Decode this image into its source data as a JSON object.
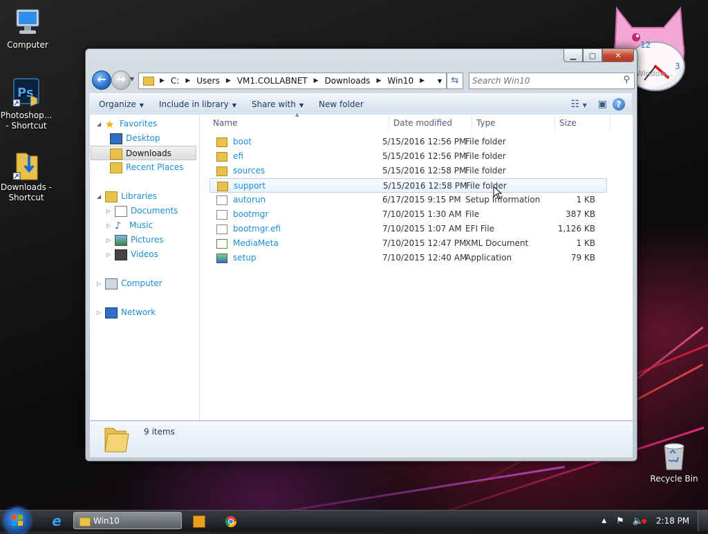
{
  "desktop": {
    "icons": [
      {
        "label": "Computer"
      },
      {
        "label": "Photoshop... - Shortcut"
      },
      {
        "label": "Downloads - Shortcut"
      },
      {
        "label": "Recycle Bin"
      }
    ],
    "gadget_text": "Window..."
  },
  "window": {
    "title": "Win10",
    "breadcrumb": [
      "C:",
      "Users",
      "VM1.COLLABNET",
      "Downloads",
      "Win10"
    ],
    "search_placeholder": "Search Win10",
    "toolbar": {
      "organize": "Organize",
      "include_in_library": "Include in library",
      "share_with": "Share with",
      "new_folder": "New folder"
    },
    "nav": {
      "favorites": "Favorites",
      "desktop": "Desktop",
      "downloads": "Downloads",
      "recent_places": "Recent Places",
      "libraries": "Libraries",
      "documents": "Documents",
      "music": "Music",
      "pictures": "Pictures",
      "videos": "Videos",
      "computer": "Computer",
      "network": "Network"
    },
    "columns": {
      "name": "Name",
      "date": "Date modified",
      "type": "Type",
      "size": "Size"
    },
    "files": [
      {
        "name": "boot",
        "date": "5/15/2016 12:56 PM",
        "type": "File folder",
        "size": "",
        "icon": "folder-icon"
      },
      {
        "name": "efi",
        "date": "5/15/2016 12:56 PM",
        "type": "File folder",
        "size": "",
        "icon": "folder-icon"
      },
      {
        "name": "sources",
        "date": "5/15/2016 12:58 PM",
        "type": "File folder",
        "size": "",
        "icon": "folder-icon"
      },
      {
        "name": "support",
        "date": "5/15/2016 12:58 PM",
        "type": "File folder",
        "size": "",
        "icon": "folder-icon"
      },
      {
        "name": "autorun",
        "date": "6/17/2015 9:15 PM",
        "type": "Setup Information",
        "size": "1 KB",
        "icon": "settings-file-icon"
      },
      {
        "name": "bootmgr",
        "date": "7/10/2015 1:30 AM",
        "type": "File",
        "size": "387 KB",
        "icon": "file-icon"
      },
      {
        "name": "bootmgr.efi",
        "date": "7/10/2015 1:07 AM",
        "type": "EFI File",
        "size": "1,126 KB",
        "icon": "file-icon"
      },
      {
        "name": "MediaMeta",
        "date": "7/10/2015 12:47 PM",
        "type": "XML Document",
        "size": "1 KB",
        "icon": "xml-file-icon"
      },
      {
        "name": "setup",
        "date": "7/10/2015 12:40 AM",
        "type": "Application",
        "size": "79 KB",
        "icon": "setup-app-icon"
      }
    ],
    "status": {
      "count": "9 items"
    }
  },
  "taskbar": {
    "task_label": "Win10",
    "clock": "2:18 PM"
  },
  "colors": {
    "link_blue": "#1a8fd8",
    "toolbar_text": "#1e395b",
    "folder_yellow": "#e8c04a"
  }
}
